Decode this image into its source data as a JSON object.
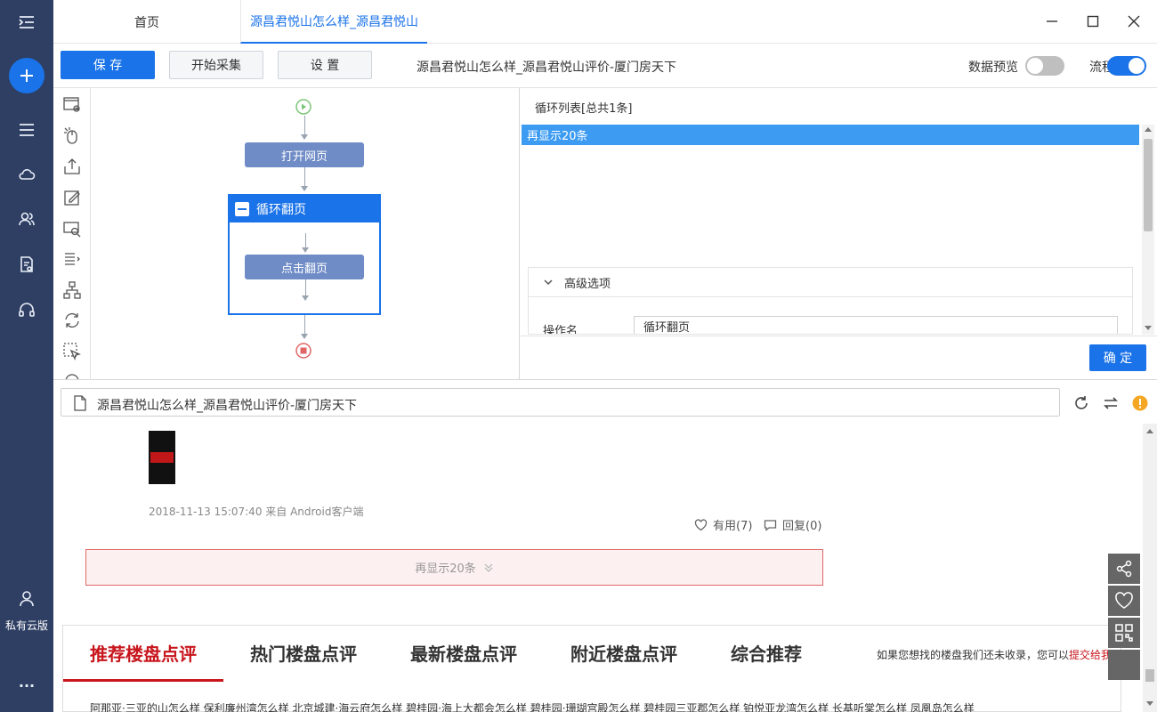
{
  "rail": {
    "private_cloud_label": "私有云版",
    "more_label": "···"
  },
  "tabs": {
    "home": "首页",
    "active": "源昌君悦山怎么样_源昌君悦山"
  },
  "toolbar": {
    "save": "保 存",
    "collect": "开始采集",
    "settings": "设 置",
    "title": "源昌君悦山怎么样_源昌君悦山评价-厦门房天下",
    "data_preview_label": "数据预览",
    "data_preview_on": false,
    "flow_label": "流程",
    "flow_on": true
  },
  "flow": {
    "open_page": "打开网页",
    "loop_label": "循环翻页",
    "click_page": "点击翻页"
  },
  "panel": {
    "loop_list_title": "循环列表[总共1条]",
    "loop_items": [
      "再显示20条"
    ],
    "advanced_label": "高级选项",
    "op_name_label": "操作名",
    "op_name_value": "循环翻页",
    "confirm": "确 定"
  },
  "urlbar": {
    "url": "源昌君悦山怎么样_源昌君悦山评价-厦门房天下"
  },
  "web": {
    "post_meta": "2018-11-13 15:07:40  来自 Android客户端",
    "useful": "有用(7)",
    "reply": "回复(0)",
    "more20": "再显示20条",
    "section_tabs": [
      "推荐楼盘点评",
      "热门楼盘点评",
      "最新楼盘点评",
      "附近楼盘点评",
      "综合推荐"
    ],
    "section_note": "如果您想找的楼盘我们还未收录，您可以",
    "section_note_link": "提交给我",
    "section_links": "阿那亚·三亚的山怎么样   保利廉州湾怎么样   北京城建·海云府怎么样   碧桂园·海上大都会怎么样   碧桂园·珊瑚宫殿怎么样   碧桂园三亚郡怎么样   铂悦亚龙湾怎么样   长基听棠怎么样   凤凰岛怎么样"
  },
  "colors": {
    "rail_bg": "#2f3f63",
    "accent": "#1a73e8",
    "flow_node": "#6f8cc6",
    "brand_red": "#c8161d"
  }
}
